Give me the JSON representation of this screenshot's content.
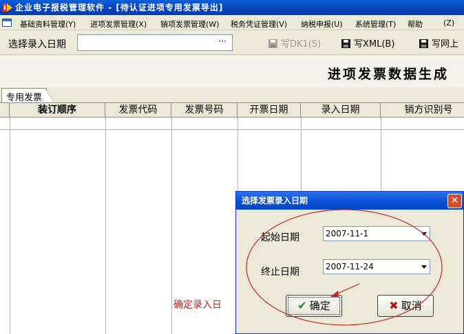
{
  "window": {
    "title": "企业电子报税管理软件 - [待认证进项专用发票导出]"
  },
  "menu": {
    "items": [
      "基础资料管理(Y)",
      "进项发票管理(X)",
      "销项发票管理(W)",
      "税务凭证管理(V)",
      "纳税申报(U)",
      "系统管理(T)",
      "帮助",
      "(Z)"
    ]
  },
  "toolbar": {
    "date_label": "选择录入日期",
    "date_value": "",
    "date_button": "···",
    "write_dk1": "写DK1(S)",
    "write_xml": "写XML(B)",
    "write_net": "写网上"
  },
  "page": {
    "title": "进项发票数据生成"
  },
  "tabs": [
    "专用发票"
  ],
  "grid": {
    "columns": [
      "装订顺序",
      "发票代码",
      "发票号码",
      "开票日期",
      "录入日期",
      "销方识别号"
    ]
  },
  "annotation": {
    "text": "确定录入日",
    "color": "#c0271e"
  },
  "dialog": {
    "title": "选择发票录入日期",
    "start_label": "起始日期",
    "start_value": "2007-11-1",
    "end_label": "终止日期",
    "end_value": "2007-11-24",
    "ok_label": "确定",
    "cancel_label": "取消",
    "close_symbol": "✕"
  }
}
